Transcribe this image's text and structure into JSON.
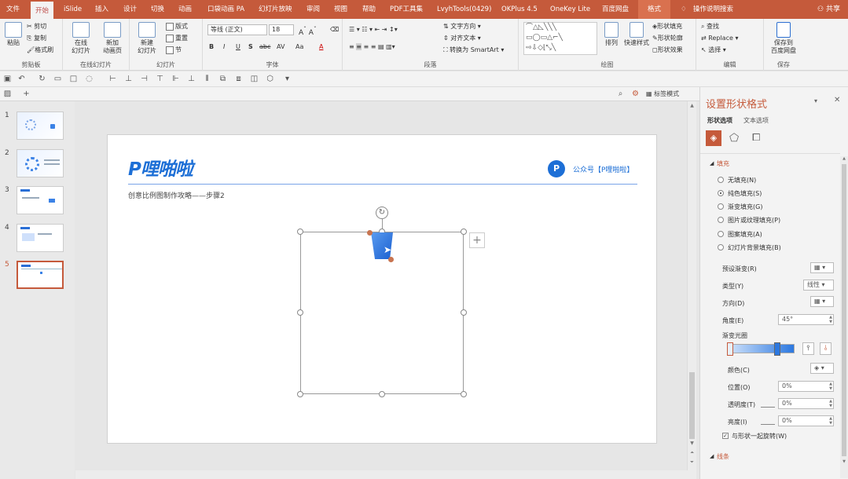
{
  "tabs": [
    "文件",
    "开始",
    "iSlide",
    "插入",
    "设计",
    "切换",
    "动画",
    "口袋动画 PA",
    "幻灯片放映",
    "审阅",
    "视图",
    "帮助",
    "PDF工具集",
    "LvyhTools(0429)",
    "OKPlus 4.5",
    "OneKey Lite",
    "百度网盘",
    "格式"
  ],
  "search_hint": "操作说明搜索",
  "share": "共享",
  "ribbon": {
    "clipboard": {
      "paste": "粘贴",
      "cut": "剪切",
      "copy": "复制",
      "format_painter": "格式刷",
      "label": "剪贴板"
    },
    "online": {
      "online_slides": "在线\n幻灯片",
      "new_anim": "新加\n动画页",
      "label": "在线幻灯片"
    },
    "slides": {
      "new_slide": "新建\n幻灯片",
      "layout": "版式",
      "reset": "重置",
      "section": "节",
      "label": "幻灯片"
    },
    "font": {
      "name": "等线 (正文)",
      "size": "18",
      "label": "字体",
      "aa": "Aa"
    },
    "paragraph": {
      "text_dir": "文字方向",
      "align_text": "对齐文本",
      "smartart": "转换为 SmartArt",
      "label": "段落"
    },
    "drawing": {
      "arrange": "排列",
      "quick_styles": "快速样式",
      "fill": "形状填充",
      "outline": "形状轮廓",
      "effects": "形状效果",
      "label": "绘图"
    },
    "editing": {
      "find": "查找",
      "replace": "Replace",
      "select": "选择",
      "label": "编辑"
    },
    "save": {
      "save_baidu": "保存到\n百度网盘",
      "label": "保存"
    }
  },
  "bar2": {
    "label_mode": "标签模式"
  },
  "thumbs": [
    "1",
    "2",
    "3",
    "4",
    "5"
  ],
  "slide": {
    "logo": "P哩啪啦",
    "account": "公众号【P哩啪啦】",
    "subtitle": "创意比例图制作攻略——步骤2"
  },
  "panel": {
    "title": "设置形状格式",
    "tab_shape": "形状选项",
    "tab_text": "文本选项",
    "fill_header": "填充",
    "options": [
      "无填充(N)",
      "纯色填充(S)",
      "渐变填充(G)",
      "图片或纹理填充(P)",
      "图案填充(A)",
      "幻灯片背景填充(B)"
    ],
    "selected_option": 1,
    "preset": "预设渐变(R)",
    "type_label": "类型(Y)",
    "type_value": "线性",
    "direction": "方向(D)",
    "angle_label": "角度(E)",
    "angle_value": "45°",
    "gradient_stops": "渐变光圈",
    "color": "颜色(C)",
    "position_label": "位置(O)",
    "position_value": "0%",
    "transparency_label": "透明度(T)",
    "transparency_value": "0%",
    "brightness_label": "亮度(I)",
    "brightness_value": "0%",
    "rotate_with_shape": "与形状一起旋转(W)",
    "line_header": "线条"
  },
  "colors": {
    "accent": "#c55a3b",
    "blue": "#1d6fd6"
  }
}
